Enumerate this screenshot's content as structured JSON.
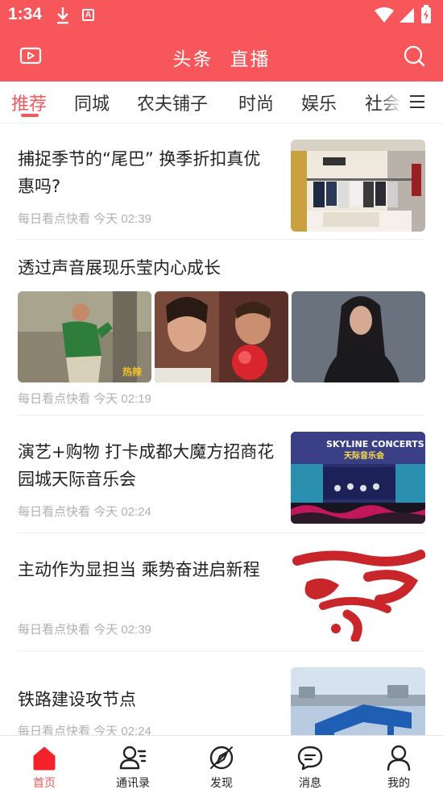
{
  "status_bar": {
    "time": "1:34",
    "badge_letter": "A"
  },
  "header": {
    "tabs": [
      "头条",
      "直播"
    ]
  },
  "categories": {
    "items": [
      "推荐",
      "同城",
      "农夫铺子",
      "时尚",
      "娱乐",
      "社会"
    ],
    "active_index": 0
  },
  "feed": {
    "articles": [
      {
        "title": "捕捉季节的“尾巴” 换季折扣真优惠吗?",
        "source": "每日看点快看",
        "time": "今天 02:39"
      },
      {
        "title": "透过声音展现乐莹内心成长",
        "source": "每日看点快看",
        "time": "今天 02:19"
      },
      {
        "title": "演艺+购物 打卡成都大魔方招商花园城天际音乐会",
        "source": "每日看点快看",
        "time": "今天 02:24",
        "image_text": [
          "SKYLINE CONCERTS",
          "天际音乐会"
        ]
      },
      {
        "title": "主动作为显担当 乘势奋进启新程",
        "source": "每日看点快看",
        "time": "今天 02:39"
      },
      {
        "title": "铁路建设攻节点",
        "source": "每日看点快看",
        "time": "今天 02:24"
      }
    ]
  },
  "bottom_nav": {
    "items": [
      {
        "label": "首页",
        "icon": "home-icon"
      },
      {
        "label": "通讯录",
        "icon": "contacts-icon"
      },
      {
        "label": "发现",
        "icon": "discover-icon"
      },
      {
        "label": "消息",
        "icon": "message-icon"
      },
      {
        "label": "我的",
        "icon": "profile-icon"
      }
    ],
    "active_index": 0
  },
  "colors": {
    "brand": "#f7575a",
    "meta_text": "#b0b0b0",
    "divider": "#ececec"
  }
}
